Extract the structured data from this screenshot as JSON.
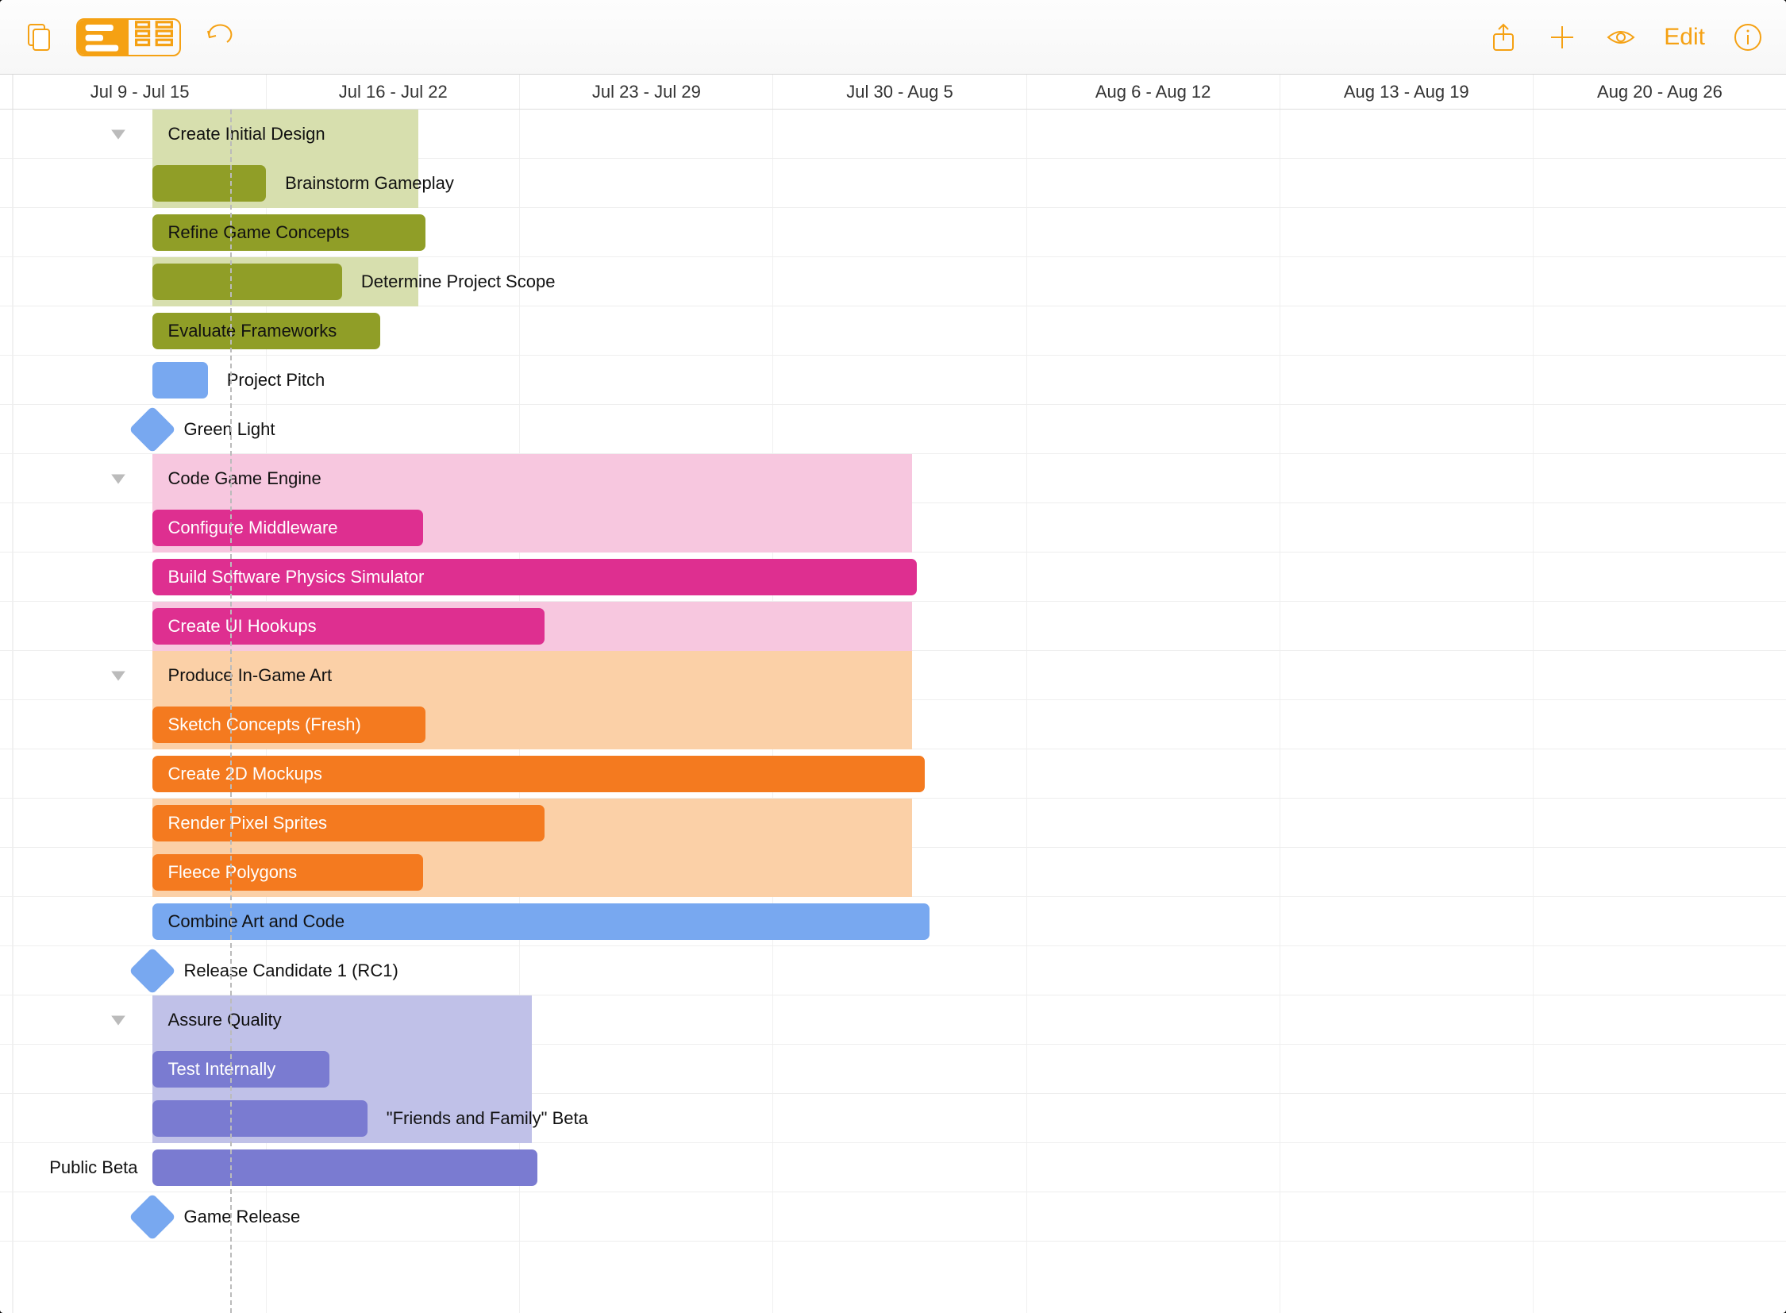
{
  "toolbar": {
    "edit_label": "Edit"
  },
  "timeline": {
    "columns": [
      "Jul 9 - Jul 15",
      "Jul 16 - Jul 22",
      "Jul 23 - Jul 29",
      "Jul 30 - Aug 5",
      "Aug 6 - Aug 12",
      "Aug 13 - Aug 19",
      "Aug 20 - Aug 26"
    ],
    "today_week_fraction_into_col0": 0.86
  },
  "colors": {
    "olive_light": "#d7dfae",
    "olive": "#909e27",
    "blue": "#78a8f0",
    "pink_light": "#f7c7df",
    "pink": "#de2f90",
    "orange_light": "#fbd0a7",
    "orange": "#f47a1f",
    "purple_light": "#c0c1e8",
    "purple": "#7a7bd1"
  },
  "rows": [
    {
      "type": "group",
      "label": "Create Initial Design",
      "color": "olive_light",
      "start": 0.55,
      "end": 1.6,
      "chevron": true
    },
    {
      "type": "task",
      "label": "Brainstorm Gameplay",
      "color": "olive",
      "start": 0.55,
      "end": 1.0,
      "label_pos": "after",
      "parent_start": 0.55,
      "parent_end": 1.6,
      "parent_color": "olive_light"
    },
    {
      "type": "task",
      "label": "Refine Game Concepts",
      "color": "olive",
      "start": 0.55,
      "end": 1.63
    },
    {
      "type": "task",
      "label": "Determine Project Scope",
      "color": "olive",
      "start": 0.55,
      "end": 1.3,
      "label_pos": "after",
      "parent_start": 0.55,
      "parent_end": 1.6,
      "parent_color": "olive_light"
    },
    {
      "type": "task",
      "label": "Evaluate Frameworks",
      "color": "olive",
      "start": 0.55,
      "end": 1.45
    },
    {
      "type": "task",
      "label": "Project Pitch",
      "color": "blue",
      "start": 0.55,
      "end": 0.77,
      "label_pos": "after"
    },
    {
      "type": "milestone",
      "label": "Green Light",
      "at": 0.55
    },
    {
      "type": "group",
      "label": "Code Game Engine",
      "color": "pink_light",
      "start": 0.55,
      "end": 3.55,
      "chevron": true
    },
    {
      "type": "task",
      "label": "Configure Middleware",
      "color": "pink",
      "start": 0.55,
      "end": 1.62,
      "text": "light",
      "parent_start": 0.55,
      "parent_end": 3.55,
      "parent_color": "pink_light"
    },
    {
      "type": "task",
      "label": "Build Software Physics Simulator",
      "color": "pink",
      "start": 0.55,
      "end": 3.57,
      "text": "light"
    },
    {
      "type": "task",
      "label": "Create UI Hookups",
      "color": "pink",
      "start": 0.55,
      "end": 2.1,
      "text": "light",
      "parent_start": 0.55,
      "parent_end": 3.55,
      "parent_color": "pink_light"
    },
    {
      "type": "group",
      "label": "Produce In-Game Art",
      "color": "orange_light",
      "start": 0.55,
      "end": 3.55,
      "chevron": true
    },
    {
      "type": "task",
      "label": "Sketch Concepts (Fresh)",
      "color": "orange",
      "start": 0.55,
      "end": 1.63,
      "text": "light",
      "parent_start": 0.55,
      "parent_end": 3.55,
      "parent_color": "orange_light"
    },
    {
      "type": "task",
      "label": "Create 2D Mockups",
      "color": "orange",
      "start": 0.55,
      "end": 3.6,
      "text": "light"
    },
    {
      "type": "task",
      "label": "Render Pixel Sprites",
      "color": "orange",
      "start": 0.55,
      "end": 2.1,
      "text": "light",
      "parent_start": 0.55,
      "parent_end": 3.55,
      "parent_color": "orange_light"
    },
    {
      "type": "task",
      "label": "Fleece Polygons",
      "color": "orange",
      "start": 0.55,
      "end": 1.62,
      "text": "light",
      "parent_start": 0.55,
      "parent_end": 3.55,
      "parent_color": "orange_light"
    },
    {
      "type": "task",
      "label": "Combine Art and Code",
      "color": "blue",
      "start": 0.55,
      "end": 3.62
    },
    {
      "type": "milestone",
      "label": "Release Candidate 1 (RC1)",
      "at": 0.55
    },
    {
      "type": "group",
      "label": "Assure Quality",
      "color": "purple_light",
      "start": 0.55,
      "end": 2.05,
      "chevron": true
    },
    {
      "type": "task",
      "label": "Test Internally",
      "color": "purple",
      "start": 0.55,
      "end": 1.25,
      "text": "light",
      "parent_start": 0.55,
      "parent_end": 2.05,
      "parent_color": "purple_light"
    },
    {
      "type": "task",
      "label": "\"Friends and Family\" Beta",
      "color": "purple",
      "start": 0.55,
      "end": 1.4,
      "label_pos": "after",
      "parent_start": 0.55,
      "parent_end": 2.05,
      "parent_color": "purple_light"
    },
    {
      "type": "task",
      "label": "Public Beta",
      "color": "purple",
      "start": 0.55,
      "end": 2.07,
      "text": "light",
      "label_prefix": "Public Beta",
      "suppress_bar_label": true
    },
    {
      "type": "milestone",
      "label": "Game Release",
      "at": 0.55
    }
  ],
  "chart_data": {
    "type": "gantt",
    "time_unit": "week",
    "columns": [
      "Jul 9 - Jul 15",
      "Jul 16 - Jul 22",
      "Jul 23 - Jul 29",
      "Jul 30 - Aug 5",
      "Aug 6 - Aug 12",
      "Aug 13 - Aug 19",
      "Aug 20 - Aug 26"
    ],
    "today_marker_week": 0.86,
    "groups": [
      {
        "name": "Create Initial Design",
        "start": 0.55,
        "end": 1.6,
        "color": "#d7dfae",
        "tasks": [
          {
            "name": "Brainstorm Gameplay",
            "start": 0.55,
            "end": 1.0,
            "color": "#909e27"
          },
          {
            "name": "Refine Game Concepts",
            "start": 0.55,
            "end": 1.63,
            "color": "#909e27"
          },
          {
            "name": "Determine Project Scope",
            "start": 0.55,
            "end": 1.3,
            "color": "#909e27"
          },
          {
            "name": "Evaluate Frameworks",
            "start": 0.55,
            "end": 1.45,
            "color": "#909e27"
          }
        ]
      },
      {
        "name": "Project Pitch",
        "start": 0.55,
        "end": 0.77,
        "color": "#78a8f0",
        "tasks": []
      },
      {
        "name": "Green Light",
        "milestone": true,
        "at": 0.55
      },
      {
        "name": "Code Game Engine",
        "start": 0.55,
        "end": 3.55,
        "color": "#f7c7df",
        "tasks": [
          {
            "name": "Configure Middleware",
            "start": 0.55,
            "end": 1.62,
            "color": "#de2f90"
          },
          {
            "name": "Build Software Physics Simulator",
            "start": 0.55,
            "end": 3.57,
            "color": "#de2f90"
          },
          {
            "name": "Create UI Hookups",
            "start": 0.55,
            "end": 2.1,
            "color": "#de2f90"
          }
        ]
      },
      {
        "name": "Produce In-Game Art",
        "start": 0.55,
        "end": 3.55,
        "color": "#fbd0a7",
        "tasks": [
          {
            "name": "Sketch Concepts (Fresh)",
            "start": 0.55,
            "end": 1.63,
            "color": "#f47a1f"
          },
          {
            "name": "Create 2D Mockups",
            "start": 0.55,
            "end": 3.6,
            "color": "#f47a1f"
          },
          {
            "name": "Render Pixel Sprites",
            "start": 0.55,
            "end": 2.1,
            "color": "#f47a1f"
          },
          {
            "name": "Fleece Polygons",
            "start": 0.55,
            "end": 1.62,
            "color": "#f47a1f"
          }
        ]
      },
      {
        "name": "Combine Art and Code",
        "start": 0.55,
        "end": 3.62,
        "color": "#78a8f0",
        "tasks": []
      },
      {
        "name": "Release Candidate 1 (RC1)",
        "milestone": true,
        "at": 0.55
      },
      {
        "name": "Assure Quality",
        "start": 0.55,
        "end": 2.05,
        "color": "#c0c1e8",
        "tasks": [
          {
            "name": "Test Internally",
            "start": 0.55,
            "end": 1.25,
            "color": "#7a7bd1"
          },
          {
            "name": "\"Friends and Family\" Beta",
            "start": 0.55,
            "end": 1.4,
            "color": "#7a7bd1"
          },
          {
            "name": "Public Beta",
            "start": 0.55,
            "end": 2.07,
            "color": "#7a7bd1"
          }
        ]
      },
      {
        "name": "Game Release",
        "milestone": true,
        "at": 0.55
      }
    ]
  }
}
